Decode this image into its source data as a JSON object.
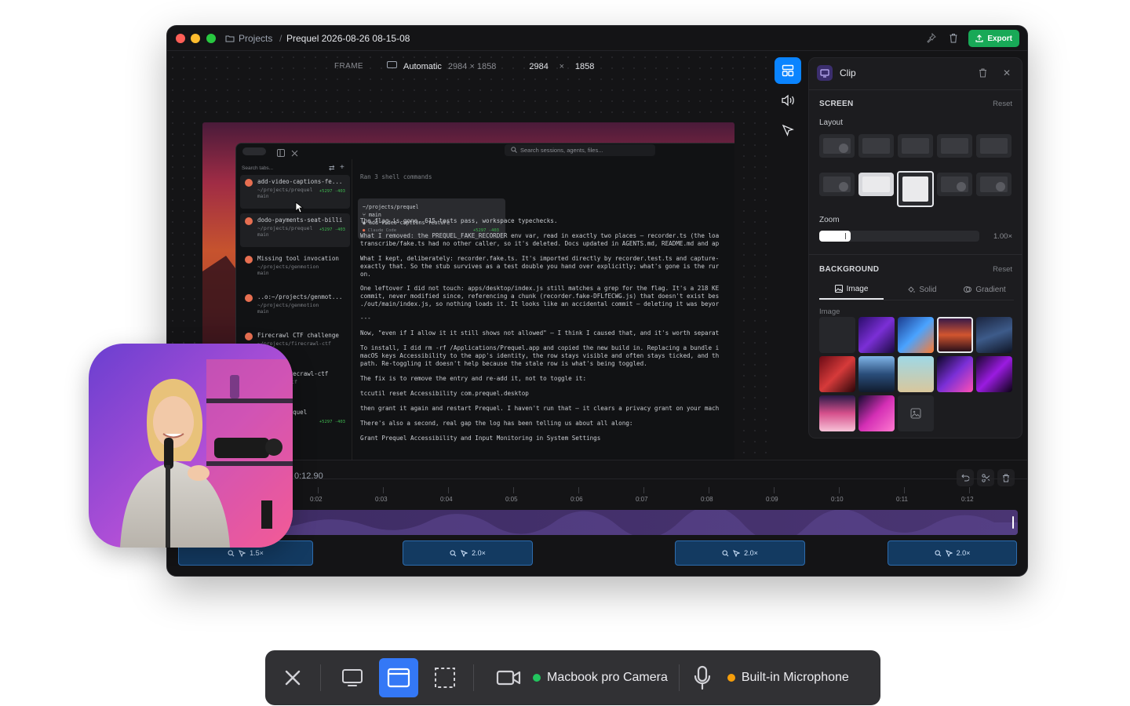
{
  "titlebar": {
    "breadcrumb_root": "Projects",
    "separator": "/",
    "project_name": "Prequel 2026-08-26 08-15-08",
    "export_label": "Export"
  },
  "frame": {
    "label": "FRAME",
    "mode": "Automatic",
    "mode_size": "2984 × 1858",
    "width": "2984",
    "times": "×",
    "height": "1858"
  },
  "inner_app": {
    "search_placeholder": "Search sessions, agents, files...",
    "search_tabs": "Search tabs...",
    "sessions": [
      {
        "title": "add-video-captions-fe...",
        "path": "~/projects/prequel",
        "branch": "main",
        "diff": "+5297 -403"
      },
      {
        "title": "dodo-payments-seat-billi",
        "path": "~/projects/prequel",
        "branch": "main",
        "diff": "+5297 -403"
      },
      {
        "title": "Missing tool invocation",
        "path": "~/projects/genmotion",
        "branch": "main",
        "diff": ""
      },
      {
        "title": "..o:~/projects/genmot...",
        "path": "~/projects/genmotion",
        "branch": "main",
        "diff": ""
      },
      {
        "title": "Firecrawl CTF challenge",
        "path": "~/projects/firecrawl-ctf",
        "branch": "",
        "diff": ""
      },
      {
        "title": "ojects/firecrawl-ctf",
        "path": "firecrawl-ctf",
        "branch": "",
        "diff": ""
      },
      {
        "title": "ojects/prequel",
        "path": "quel",
        "branch": "",
        "diff": "+5297 -403"
      }
    ],
    "tooltip": {
      "path": "~/projects/prequel",
      "branch": "main",
      "name": "add-video-captions-feature",
      "agent": "Claude Code",
      "diff": "+5297 -403"
    },
    "ran": "Ran 3 shell commands",
    "lines": [
      "The flag is gone. 615 tests pass, workspace typechecks.",
      "What I removed: the PREQUEL_FAKE_RECORDER env var, read in exactly two places — recorder.ts (the loa",
      "transcribe/fake.ts had no other caller, so it's deleted. Docs updated in AGENTS.md, README.md and ap",
      "What I kept, deliberately: recorder.fake.ts. It's imported directly by recorder.test.ts and capture-",
      "exactly that. So the stub survives as a test double you hand over explicitly; what's gone is the rur",
      "on.",
      "One leftover I did not touch: apps/desktop/index.js still matches a grep for the flag. It's a 218 KE",
      "commit, never modified since, referencing a chunk (recorder.fake-DFLfECWG.js) that doesn't exist bes",
      "./out/main/index.js, so nothing loads it. It looks like an accidental commit — deleting it was beyor",
      "---",
      "Now, \"even if I allow it it still shows not allowed\" — I think I caused that, and it's worth separat",
      "To install, I did rm -rf /Applications/Prequel.app and copied the new build in. Replacing a bundle i",
      "macOS keys Accessibility to the app's identity, the row stays visible and often stays ticked, and th",
      "path. Re-toggling it doesn't help because the stale row is what's being toggled.",
      "The fix is to remove the entry and re-add it, not to toggle it:",
      "tccutil reset Accessibility com.prequel.desktop",
      "then grant it again and restart Prequel. I haven't run that — it clears a privacy grant on your mach",
      "There's also a second, real gap the log has been telling us about all along:",
      "Grant Prequel Accessibility and Input Monitoring in System Settings"
    ]
  },
  "panel": {
    "title": "Clip",
    "screen_label": "SCREEN",
    "reset": "Reset",
    "layout_label": "Layout",
    "zoom_label": "Zoom",
    "zoom_value": 1.0,
    "zoom_text": "1.00×",
    "background_label": "BACKGROUND",
    "tabs": [
      "Image",
      "Solid",
      "Gradient"
    ],
    "image_label": "Image",
    "selected_layout": 7,
    "selected_thumb": 3
  },
  "timeline": {
    "time": "0:12.90",
    "ticks": [
      "0:02",
      "0:03",
      "0:04",
      "0:05",
      "0:06",
      "0:07",
      "0:08",
      "0:09",
      "0:10",
      "0:11",
      "0:12"
    ],
    "clips": [
      "1.5×",
      "2.0×",
      "2.0×",
      "2.0×"
    ]
  },
  "recorder": {
    "camera_label": "Macbook pro Camera",
    "mic_label": "Built-in Microphone",
    "camera_status_color": "#22c55e",
    "mic_status_color": "#f59e0b",
    "active_mode": "window"
  },
  "colors": {
    "accent": "#0a84ff",
    "export": "#18a957",
    "clip": "#133a61"
  }
}
